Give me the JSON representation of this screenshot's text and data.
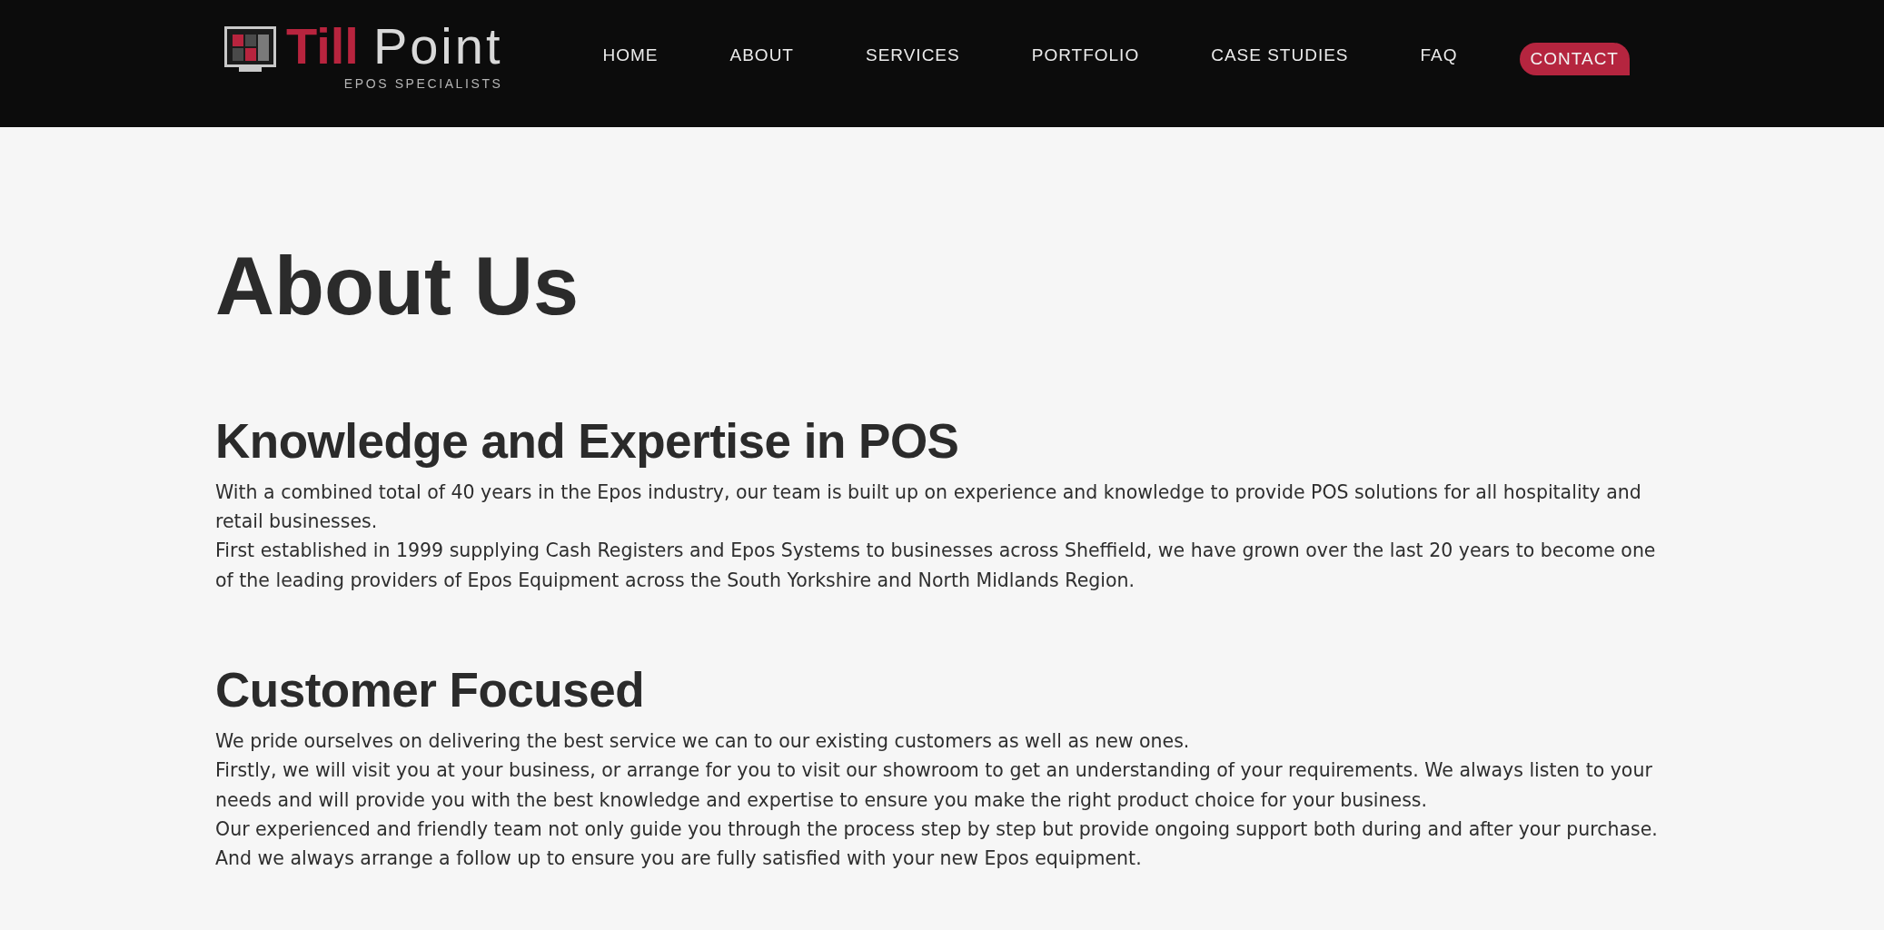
{
  "header": {
    "logo": {
      "name_part_1": "Till",
      "name_part_2": "Point",
      "tagline": "EPOS SPECIALISTS"
    },
    "nav": [
      {
        "label": "HOME",
        "kind": "link"
      },
      {
        "label": "ABOUT",
        "kind": "link"
      },
      {
        "label": "SERVICES",
        "kind": "link"
      },
      {
        "label": "PORTFOLIO",
        "kind": "link"
      },
      {
        "label": "CASE STUDIES",
        "kind": "link"
      },
      {
        "label": "FAQ",
        "kind": "link"
      },
      {
        "label": "CONTACT",
        "kind": "button"
      }
    ]
  },
  "page": {
    "title": "About Us",
    "sections": [
      {
        "heading": "Knowledge and Expertise in POS",
        "paragraphs": [
          "With a combined total of 40 years in the Epos industry, our team is built up on experience and knowledge to provide POS solutions for all hospitality and retail businesses.",
          "First established in 1999 supplying Cash Registers and Epos Systems to businesses across Sheffield, we have grown over the last 20 years to become one of the leading providers of Epos Equipment across the South Yorkshire and North Midlands Region."
        ]
      },
      {
        "heading": "Customer Focused",
        "paragraphs": [
          "We pride ourselves on delivering the best service we can to our existing customers as well as new ones.",
          "Firstly, we will visit you at your business, or arrange for you to visit our showroom to get an understanding of your requirements. We always listen to your needs and will provide you with the best knowledge and expertise to ensure you make the right product choice for your business.",
          "Our experienced and friendly team not only guide you through the process step by step but provide ongoing support both during and after your purchase. And we always arrange a follow up to ensure you are fully satisfied with your new Epos equipment."
        ]
      }
    ]
  }
}
